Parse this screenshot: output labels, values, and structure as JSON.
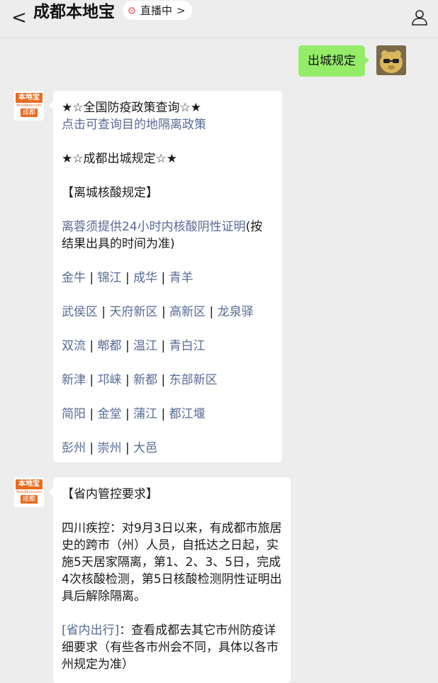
{
  "header": {
    "back_label": "<",
    "title": "成都本地宝",
    "live_label": "直播中",
    "live_chevron": ">",
    "user_icon": "person-icon"
  },
  "messages": {
    "outgoing_text": "出城规定",
    "bot_avatar": {
      "logo_top": "本地宝",
      "logo_mid": "Bendibao.com",
      "logo_bottom": "成都"
    },
    "msg1": {
      "heading1": "★☆全国防疫政策查询☆★",
      "link1": "点击可查询目的地隔离政策",
      "heading2": "★☆成都出城规定☆★",
      "section": "【离城核酸规定】",
      "policy_link": "离蓉须提供24小时内核酸阴性证明",
      "policy_rest": "(按结果出具的时间为准)",
      "district_rows": [
        [
          "金牛",
          "锦江",
          "成华",
          " 青羊"
        ],
        [
          "武侯区",
          "天府新区",
          "高新区",
          "龙泉驿"
        ],
        [
          "双流",
          "郫都",
          "温江",
          "青白江"
        ],
        [
          "新津",
          "邛崃",
          "新都",
          "东部新区"
        ],
        [
          "简阳",
          "金堂",
          "蒲江",
          "都江堰"
        ],
        [
          "彭州",
          "崇州",
          "大邑"
        ]
      ],
      "separator": " | "
    },
    "msg2": {
      "section": "【省内管控要求】",
      "body": "四川疾控：对9月3日以来，有成都市旅居史的跨市（州）人员，自抵达之日起，实施5天居家隔离，第1、2、3、5日，完成4次核酸检测，第5日核酸检测阴性证明出具后解除隔离。",
      "link_label": "[省内出行]",
      "tail": "：查看成都去其它市州防疫详细要求（有些各市州会不同，具体以各市州规定为准）"
    }
  },
  "colors": {
    "background": "#ededed",
    "outgoing_bubble": "#95ec69",
    "link": "#576b95",
    "brand_orange": "#e96b1f"
  }
}
